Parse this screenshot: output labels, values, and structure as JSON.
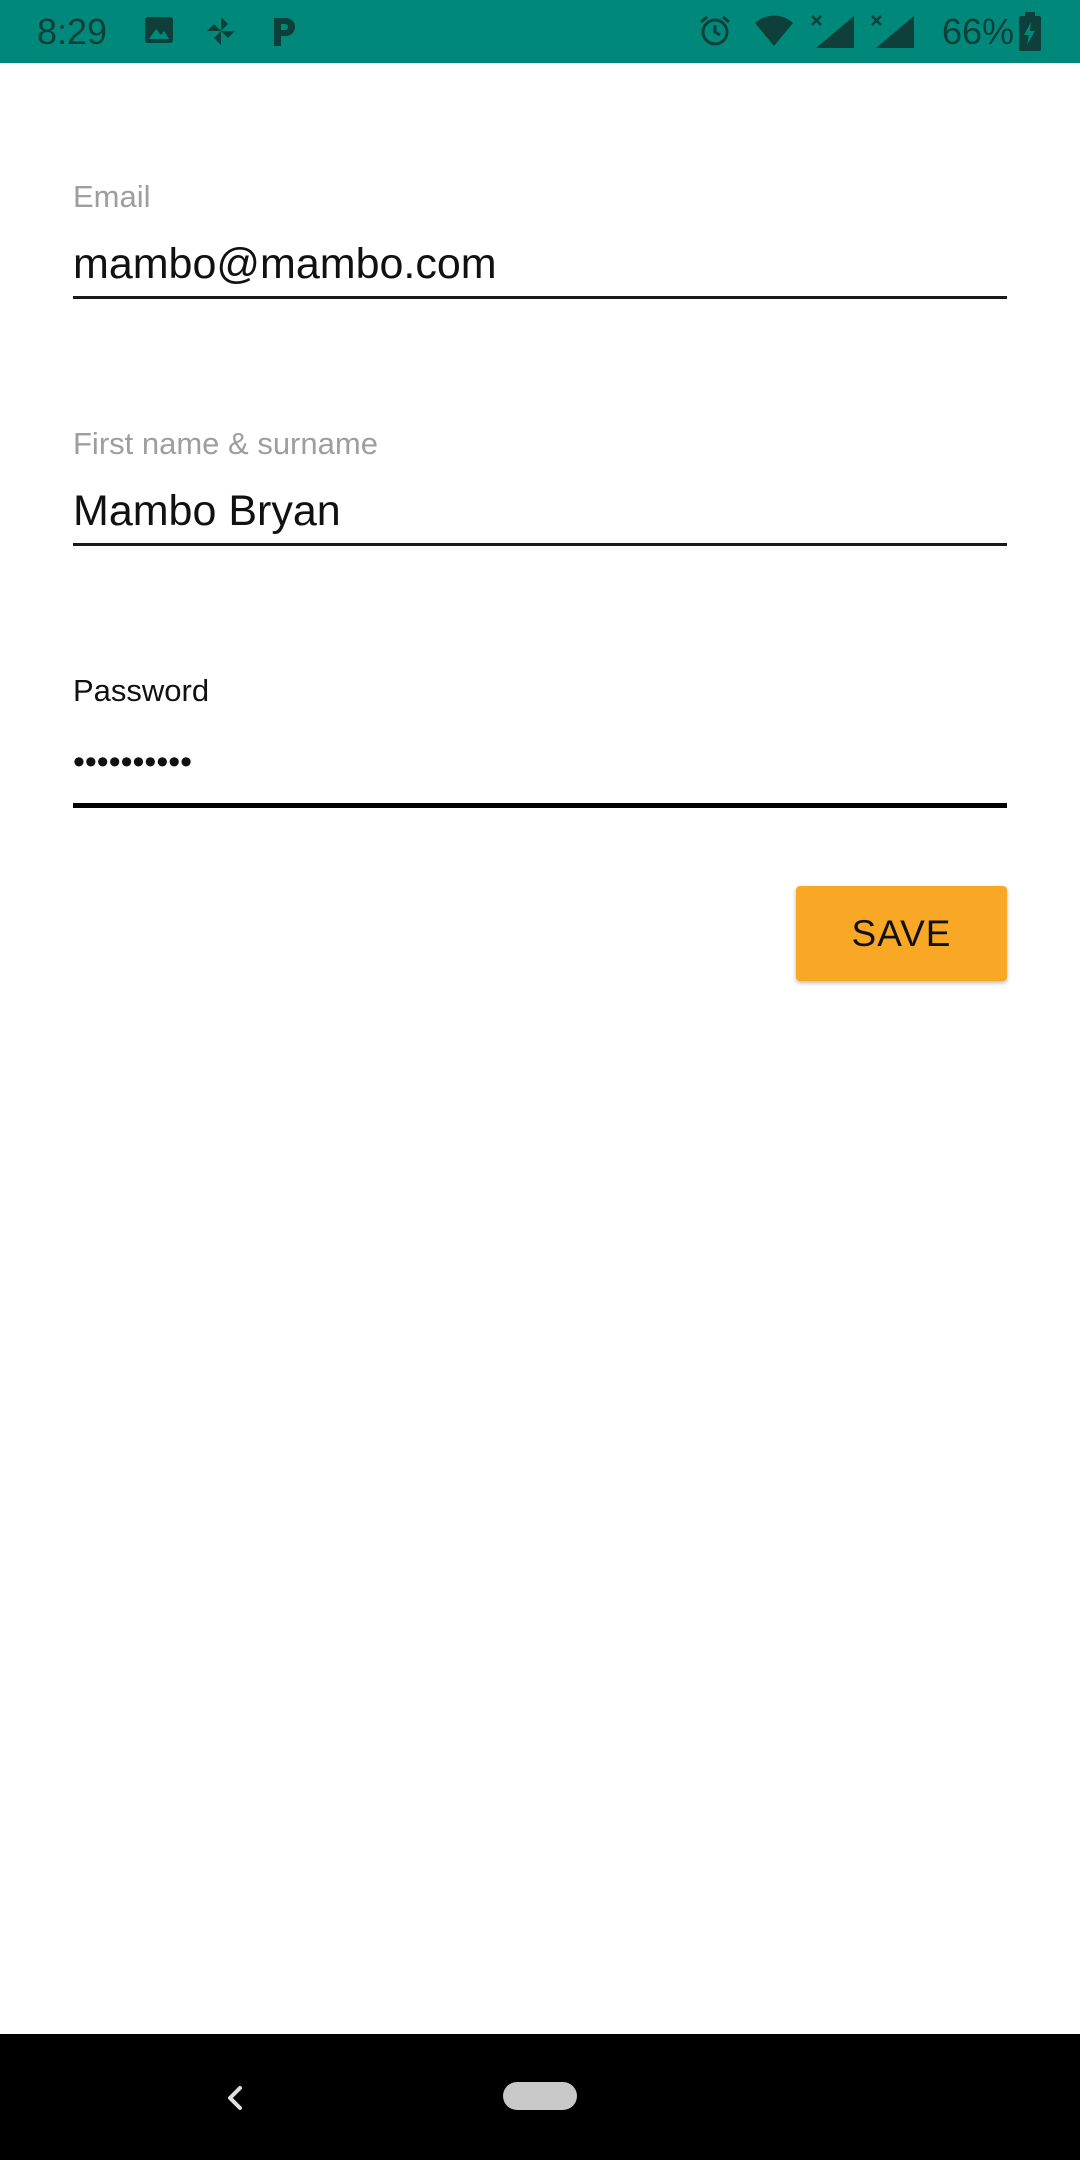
{
  "status_bar": {
    "time": "8:29",
    "battery": "66%",
    "background_color": "#00897b",
    "icons": [
      "image-icon",
      "pinwheel-icon",
      "parking-app-icon",
      "alarm-icon",
      "wifi-icon",
      "signal-x-icon",
      "signal-x-icon",
      "battery-charging-icon"
    ]
  },
  "form": {
    "email": {
      "label": "Email",
      "value": "mambo@mambo.com"
    },
    "name": {
      "label": "First name & surname",
      "value": "Mambo Bryan"
    },
    "password": {
      "label": "Password",
      "value": "••••••••••"
    },
    "save_label": "SAVE",
    "save_color": "#f9a825"
  },
  "nav_bar": {
    "icons": [
      "back-icon",
      "home-pill-icon"
    ]
  }
}
